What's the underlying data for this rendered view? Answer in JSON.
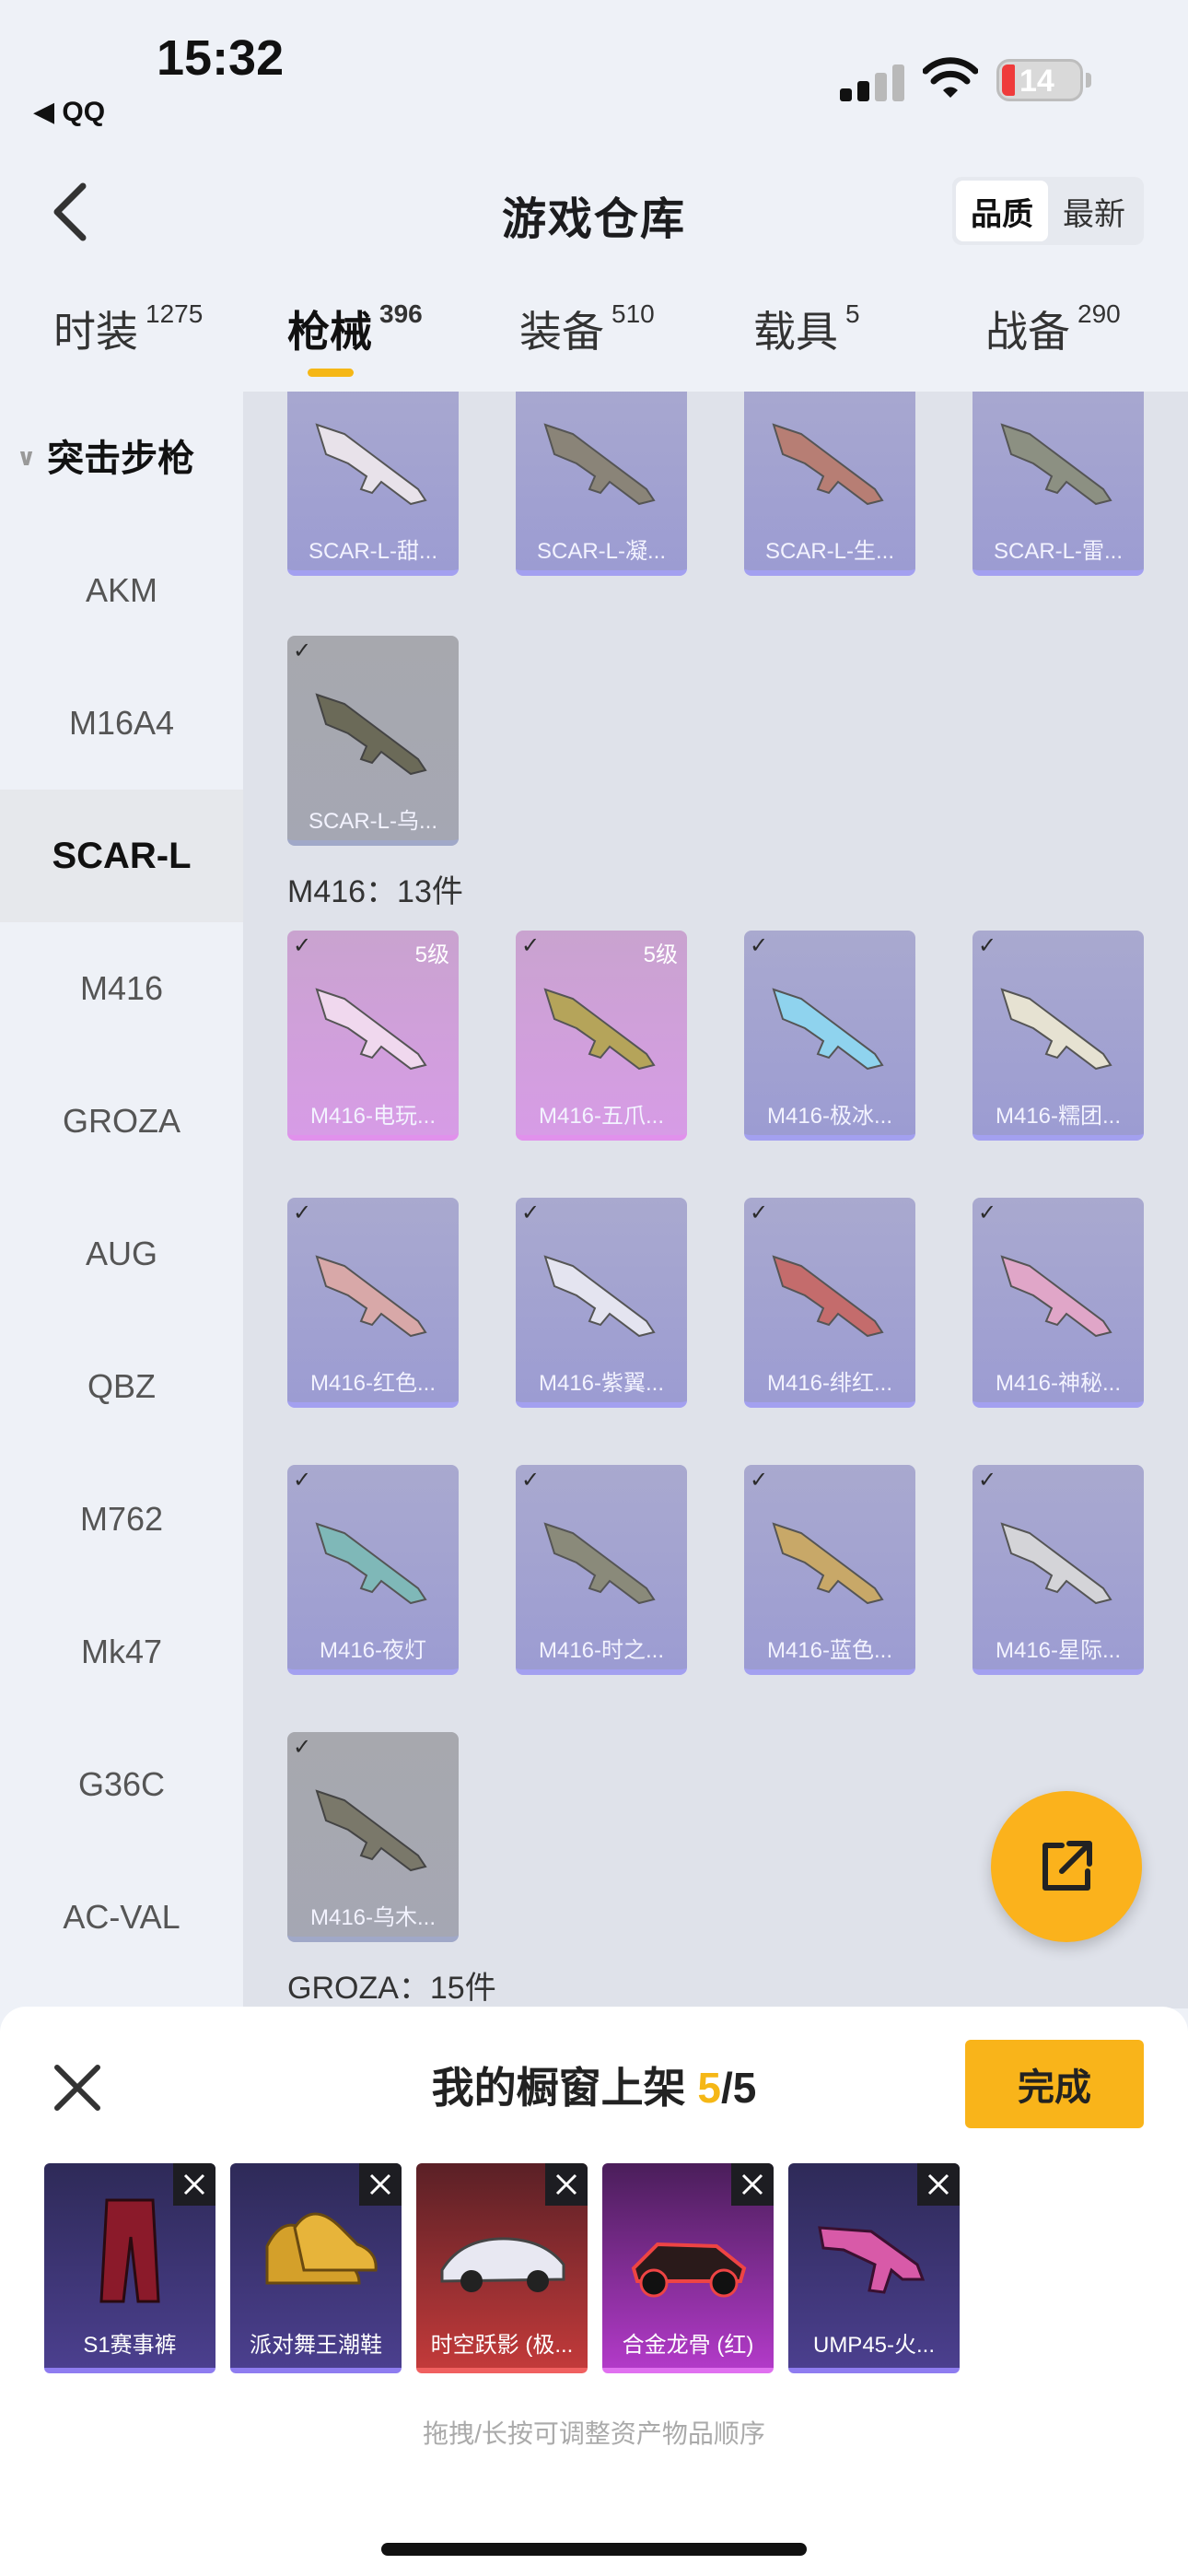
{
  "status": {
    "time": "15:32",
    "back_app": "◀ QQ",
    "battery": "14"
  },
  "header": {
    "title": "游戏仓库",
    "sort": [
      "品质",
      "最新"
    ]
  },
  "tabs": [
    {
      "label": "时装",
      "count": "1275"
    },
    {
      "label": "枪械",
      "count": "396"
    },
    {
      "label": "装备",
      "count": "510"
    },
    {
      "label": "载具",
      "count": "5"
    },
    {
      "label": "战备",
      "count": "290"
    }
  ],
  "sidebar": {
    "category": "突击步枪",
    "items": [
      "AKM",
      "M16A4",
      "SCAR-L",
      "M416",
      "GROZA",
      "AUG",
      "QBZ",
      "M762",
      "Mk47",
      "G36C",
      "AC-VAL"
    ]
  },
  "grid": {
    "scar_items": [
      "SCAR-L-甜...",
      "SCAR-L-凝...",
      "SCAR-L-生...",
      "SCAR-L-雷...",
      "SCAR-L-乌..."
    ],
    "m416_title": "M416：13件",
    "m416_items": [
      {
        "name": "M416-电玩...",
        "level": "5级"
      },
      {
        "name": "M416-五爪...",
        "level": "5级"
      },
      {
        "name": "M416-极冰..."
      },
      {
        "name": "M416-糯团..."
      },
      {
        "name": "M416-红色..."
      },
      {
        "name": "M416-紫翼..."
      },
      {
        "name": "M416-绯红..."
      },
      {
        "name": "M416-神秘..."
      },
      {
        "name": "M416-夜灯"
      },
      {
        "name": "M416-时之..."
      },
      {
        "name": "M416-蓝色..."
      },
      {
        "name": "M416-星际..."
      },
      {
        "name": "M416-乌木..."
      }
    ],
    "groza_title": "GROZA：15件"
  },
  "panel": {
    "title_prefix": "我的橱窗上架 ",
    "count": "5",
    "total": "/5",
    "done": "完成",
    "items": [
      "S1赛事裤",
      "派对舞王潮鞋",
      "时空跃影 (极...",
      "合金龙骨 (红)",
      "UMP45-火..."
    ],
    "hint": "拖拽/长按可调整资产物品顺序"
  },
  "colors": {
    "accent": "#f5b716",
    "fab": "#fbb21c"
  }
}
